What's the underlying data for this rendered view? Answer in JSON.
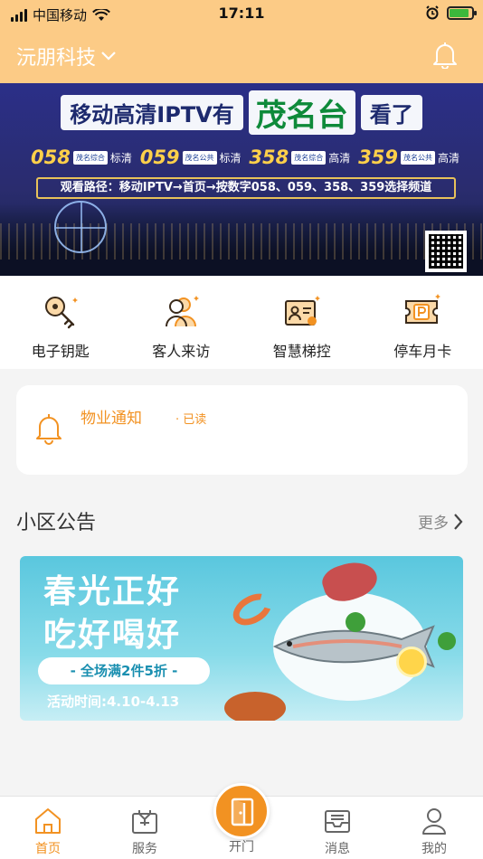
{
  "status_bar": {
    "carrier": "中国移动",
    "time": "17:11"
  },
  "header": {
    "company": "沅朋科技"
  },
  "banner": {
    "headline_prefix": "移动高清IPTV有",
    "headline_main": "茂名台",
    "headline_suffix": "看了",
    "channels": [
      {
        "number": "058",
        "logo": "茂名综合",
        "quality": "标清"
      },
      {
        "number": "059",
        "logo": "茂名公共",
        "quality": "标清"
      },
      {
        "number": "358",
        "logo": "茂名综合",
        "quality": "高清"
      },
      {
        "number": "359",
        "logo": "茂名公共",
        "quality": "高清"
      }
    ],
    "path_text": "观看路径：移动IPTV→首页→按数字058、059、358、359选择频道"
  },
  "quick_actions": [
    {
      "label": "电子钥匙",
      "icon": "key-icon"
    },
    {
      "label": "客人来访",
      "icon": "visitors-icon"
    },
    {
      "label": "智慧梯控",
      "icon": "elevator-card-icon"
    },
    {
      "label": "停车月卡",
      "icon": "parking-card-icon"
    }
  ],
  "notice": {
    "title": "物业通知",
    "status": "· 已读"
  },
  "announcements": {
    "title": "小区公告",
    "more": "更多",
    "promo": {
      "line1": "春光正好",
      "line2": "吃好喝好",
      "offer": "- 全场满2件5折 -",
      "period": "活动时间:4.10-4.13"
    }
  },
  "tabs": [
    {
      "label": "首页",
      "icon": "home-icon",
      "active": true
    },
    {
      "label": "服务",
      "icon": "service-icon",
      "active": false
    },
    {
      "label": "开门",
      "icon": "door-icon",
      "active": false
    },
    {
      "label": "消息",
      "icon": "message-icon",
      "active": false
    },
    {
      "label": "我的",
      "icon": "profile-icon",
      "active": false
    }
  ],
  "colors": {
    "header_bg": "#fccb86",
    "accent": "#f29222"
  }
}
